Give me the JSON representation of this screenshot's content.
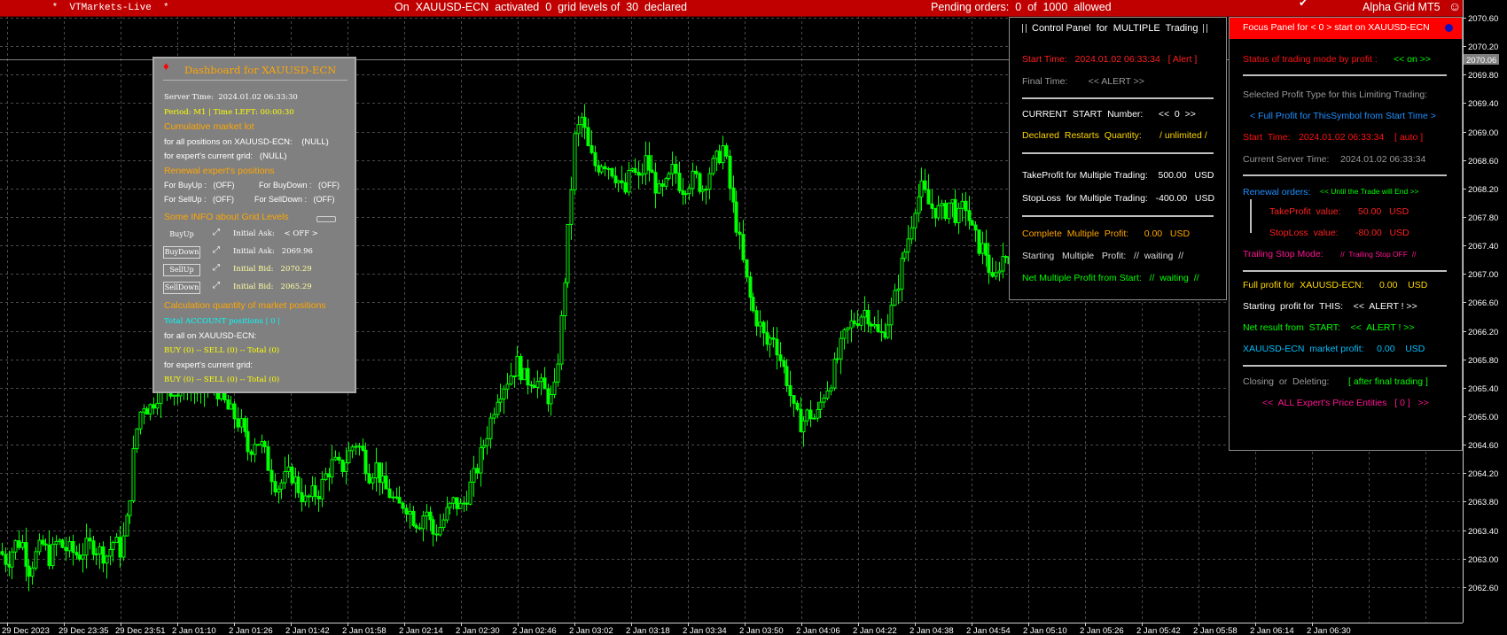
{
  "window": {
    "account": " *  VTMarkets-Live  *",
    "status": "On  XAUUSD-ECN  activated  0  grid levels of  30  declared",
    "pending": "Pending orders:  0  of  1000  allowed",
    "expert": "Alpha Grid MT5",
    "check_icon": "✔",
    "smile_icon": "☺"
  },
  "colors": {
    "bull": "#00ff00",
    "bear": "#00ff00",
    "grid": "#4a4a4a",
    "background": "#000000",
    "topbar": "#c00000",
    "dashboard": "#808080",
    "focus_header": "#ff0000",
    "price_tag": "#7f7f7f"
  },
  "chart": {
    "symbol": "XAUUSD-ECN",
    "timeframe": "M1",
    "y_ticks": [
      "2070.60",
      "2070.20",
      "2069.80",
      "2069.40",
      "2069.00",
      "2068.60",
      "2068.20",
      "2067.80",
      "2067.40",
      "2067.00",
      "2066.60",
      "2066.20",
      "2065.80",
      "2065.40",
      "2065.00",
      "2064.60",
      "2064.20",
      "2063.80",
      "2063.40",
      "2063.00",
      "2062.60"
    ],
    "current_price": "2070.06",
    "x_ticks": [
      "29 Dec 2023",
      "29 Dec 23:35",
      "29 Dec 23:51",
      "2 Jan 01:10",
      "2 Jan 01:26",
      "2 Jan 01:42",
      "2 Jan 01:58",
      "2 Jan 02:14",
      "2 Jan 02:30",
      "2 Jan 02:46",
      "2 Jan 03:02",
      "2 Jan 03:18",
      "2 Jan 03:34",
      "2 Jan 03:50",
      "2 Jan 04:06",
      "2 Jan 04:22",
      "2 Jan 04:38",
      "2 Jan 04:54",
      "2 Jan 05:10",
      "2 Jan 05:26",
      "2 Jan 05:42",
      "2 Jan 05:58",
      "2 Jan 06:14",
      "2 Jan 06:30"
    ]
  },
  "chart_data": {
    "type": "candlestick",
    "title": "",
    "ylim": [
      2062.35,
      2070.8
    ],
    "close_path": [
      [
        0,
        2063.1
      ],
      [
        8,
        2062.95
      ],
      [
        16,
        2063.2
      ],
      [
        24,
        2063.25
      ],
      [
        32,
        2062.85
      ],
      [
        40,
        2063.05
      ],
      [
        48,
        2063.2
      ],
      [
        56,
        2063.0
      ],
      [
        64,
        2063.25
      ],
      [
        72,
        2063.15
      ],
      [
        80,
        2063.1
      ],
      [
        88,
        2063.05
      ],
      [
        96,
        2063.15
      ],
      [
        104,
        2063.2
      ],
      [
        112,
        2063.1
      ],
      [
        120,
        2063.05
      ],
      [
        128,
        2063.25
      ],
      [
        136,
        2063.1
      ],
      [
        144,
        2063.6
      ],
      [
        152,
        2064.7
      ],
      [
        160,
        2065.2
      ],
      [
        168,
        2065.1
      ],
      [
        176,
        2065.3
      ],
      [
        184,
        2065.5
      ],
      [
        192,
        2065.4
      ],
      [
        200,
        2065.3
      ],
      [
        208,
        2065.5
      ],
      [
        216,
        2065.4
      ],
      [
        224,
        2065.25
      ],
      [
        232,
        2065.4
      ],
      [
        240,
        2065.5
      ],
      [
        248,
        2065.3
      ],
      [
        256,
        2065.1
      ],
      [
        264,
        2065.0
      ],
      [
        272,
        2064.85
      ],
      [
        280,
        2064.5
      ],
      [
        288,
        2064.7
      ],
      [
        296,
        2064.55
      ],
      [
        304,
        2064.25
      ],
      [
        312,
        2064.0
      ],
      [
        320,
        2064.1
      ],
      [
        328,
        2064.2
      ],
      [
        336,
        2064.0
      ],
      [
        344,
        2063.8
      ],
      [
        352,
        2063.9
      ],
      [
        360,
        2063.95
      ],
      [
        368,
        2064.2
      ],
      [
        376,
        2064.35
      ],
      [
        384,
        2064.25
      ],
      [
        392,
        2064.45
      ],
      [
        400,
        2064.65
      ],
      [
        408,
        2064.5
      ],
      [
        416,
        2064.2
      ],
      [
        424,
        2064.3
      ],
      [
        432,
        2064.0
      ],
      [
        440,
        2063.9
      ],
      [
        448,
        2063.7
      ],
      [
        456,
        2063.8
      ],
      [
        464,
        2063.6
      ],
      [
        472,
        2063.5
      ],
      [
        480,
        2063.7
      ],
      [
        488,
        2063.35
      ],
      [
        496,
        2063.45
      ],
      [
        504,
        2063.65
      ],
      [
        512,
        2063.8
      ],
      [
        520,
        2063.7
      ],
      [
        528,
        2063.95
      ],
      [
        536,
        2064.2
      ],
      [
        544,
        2064.55
      ],
      [
        552,
        2064.9
      ],
      [
        560,
        2065.3
      ],
      [
        568,
        2065.45
      ],
      [
        576,
        2065.6
      ],
      [
        584,
        2065.75
      ],
      [
        592,
        2065.5
      ],
      [
        600,
        2065.55
      ],
      [
        608,
        2065.45
      ],
      [
        616,
        2065.3
      ],
      [
        624,
        2065.2
      ],
      [
        632,
        2066.2
      ],
      [
        640,
        2067.5
      ],
      [
        648,
        2068.9
      ],
      [
        656,
        2069.2
      ],
      [
        664,
        2068.7
      ],
      [
        672,
        2068.5
      ],
      [
        680,
        2068.6
      ],
      [
        688,
        2068.5
      ],
      [
        696,
        2068.35
      ],
      [
        704,
        2068.1
      ],
      [
        712,
        2068.5
      ],
      [
        720,
        2068.3
      ],
      [
        728,
        2068.6
      ],
      [
        736,
        2068.35
      ],
      [
        744,
        2068.1
      ],
      [
        752,
        2068.25
      ],
      [
        760,
        2068.5
      ],
      [
        768,
        2068.2
      ],
      [
        776,
        2068.3
      ],
      [
        784,
        2068.35
      ],
      [
        792,
        2068.2
      ],
      [
        800,
        2068.45
      ],
      [
        808,
        2068.6
      ],
      [
        816,
        2068.8
      ],
      [
        824,
        2068.1
      ],
      [
        832,
        2067.6
      ],
      [
        840,
        2067.0
      ],
      [
        848,
        2066.5
      ],
      [
        856,
        2066.3
      ],
      [
        864,
        2066.0
      ],
      [
        872,
        2066.15
      ],
      [
        880,
        2065.8
      ],
      [
        888,
        2065.5
      ],
      [
        896,
        2065.0
      ],
      [
        904,
        2064.9
      ],
      [
        912,
        2065.05
      ],
      [
        920,
        2064.95
      ],
      [
        928,
        2065.3
      ],
      [
        936,
        2065.5
      ],
      [
        944,
        2065.8
      ],
      [
        952,
        2066.1
      ],
      [
        960,
        2066.3
      ],
      [
        968,
        2066.4
      ],
      [
        976,
        2066.5
      ],
      [
        984,
        2066.3
      ],
      [
        992,
        2066.1
      ],
      [
        1000,
        2066.3
      ],
      [
        1008,
        2066.6
      ],
      [
        1016,
        2067.1
      ],
      [
        1024,
        2067.5
      ],
      [
        1032,
        2068.0
      ],
      [
        1040,
        2068.2
      ],
      [
        1048,
        2067.95
      ],
      [
        1056,
        2067.9
      ],
      [
        1064,
        2067.85
      ],
      [
        1072,
        2068.05
      ],
      [
        1080,
        2067.75
      ],
      [
        1088,
        2068.0
      ],
      [
        1096,
        2067.6
      ],
      [
        1104,
        2067.4
      ],
      [
        1112,
        2067.3
      ],
      [
        1120,
        2066.8
      ],
      [
        1128,
        2067.2
      ],
      [
        1136,
        2067.3
      ],
      [
        1142,
        2067.25
      ]
    ]
  },
  "dashboard": {
    "marker": "♦",
    "title": "Dashboard for XAUUSD-ECN",
    "server_time": "Server Time:  2024.01.02 06:33:30",
    "period": "Period: M1 | Time LEFT: 00:00:30",
    "cumulative_title": "Cumulative market lot",
    "cum_all": "for all positions on XAUUSD-ECN:    (NULL)",
    "cum_grid": "for expert's current grid:   (NULL)",
    "renewal_title": "Renewal expert's positions",
    "for_buyup": "For BuyUp :   (OFF)",
    "for_buydown": "For BuyDown :   (OFF)",
    "for_sellup": "For SellUp :   (OFF)",
    "for_selldown": "For SellDown :   (OFF)",
    "info_title": "Some INFO about Grid Levels",
    "grid": [
      {
        "button": "BuyUp",
        "label": "Initial Ask:    < OFF >",
        "icon": "link-icon"
      },
      {
        "button": "BuyDown",
        "label": "Initial Ask:   2069.96",
        "icon": "link-icon"
      },
      {
        "button": "SellUp",
        "label": "Initial Bid:   2070.29",
        "icon": "link-icon"
      },
      {
        "button": "SellDown",
        "label": "Initial Bid:   2065.29",
        "icon": "link-icon"
      }
    ],
    "calc_title": "Calculation quantity of market positions",
    "total_account": "Total ACCOUNT positions | 0 |",
    "for_all_on": "for all on XAUUSD-ECN:",
    "line_all": "BUY (0) -- SELL (0) -- Total (0)",
    "for_grid": "for expert's current grid:",
    "line_grid": "BUY (0) -- SELL (0) -- Total (0)"
  },
  "control": {
    "title": "Control Panel  for  MULTIPLE  Trading",
    "start_time": "Start Time:   2024.01.02 06:33:34   [ Alert ]",
    "final_time": "Final Time:        << ALERT >>",
    "current_start": "CURRENT  START  Number:      <<  0  >>",
    "declared_label": "Declared  Restarts  Quantity:",
    "declared_value": "/ unlimited /",
    "takeprofit": "TakeProfit for Multiple Trading:    500.00   USD",
    "stoploss": "StopLoss  for Multiple Trading:   -400.00   USD",
    "complete": "Complete  Multiple  Profit:      0.00   USD",
    "starting": "Starting   Multiple   Profit:   //  waiting  //",
    "net": "Net Multiple Profit from Start:   //  waiting  //"
  },
  "focus": {
    "header": "Focus Panel for < 0 > start on XAUUSD-ECN",
    "status_label": "Status of trading mode by profit :",
    "status_value": "<< on >>",
    "selected_type": "Selected Profit Type for this Limiting Trading:",
    "full_profit": "< Full Profit for ThisSymbol from Start Time >",
    "start_time_label": "Start  Time:",
    "start_time_value": "2024.01.02 06:33:34    [ auto ]",
    "server_time_label": "Current Server Time:",
    "server_time_value": "2024.01.02 06:33:34",
    "renewal_label": "Renewal orders:",
    "renewal_value": "<< Until the Trade will End >>",
    "tp_label": "TakeProfit  value:",
    "tp_value": "50.00   USD",
    "sl_label": "StopLoss  value:",
    "sl_value": "-80.00   USD",
    "trailing_label": "Trailing Stop Mode:",
    "trailing_value": "//  Trailing Stop OFF  //",
    "full_profit_sym": "Full profit for  XAUUSD-ECN:      0.00    USD",
    "starting_profit": "Starting  profit for  THIS:    <<  ALERT ! >>",
    "net_result": "Net result from  START:    <<  ALERT ! >>",
    "market_profit": "XAUUSD-ECN  market profit:     0.00    USD",
    "closing_label": "Closing  or  Deleting:",
    "closing_value": "[ after final trading ]",
    "entities": "<<  ALL Expert's Price Entities   [ 0 ]   >>"
  }
}
